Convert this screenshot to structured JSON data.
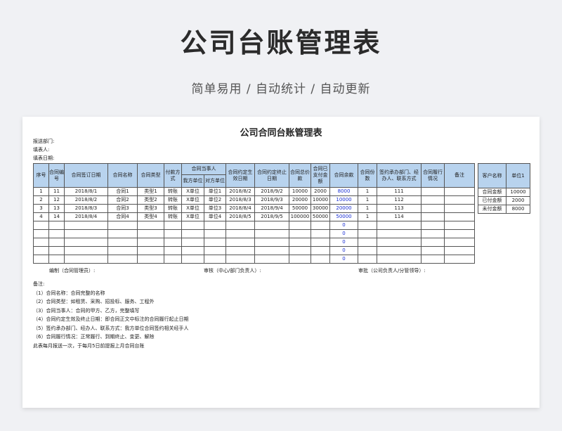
{
  "hero": {
    "title": "公司台账管理表",
    "subtitle": "简单易用 / 自动统计 / 自动更新"
  },
  "sheet": {
    "title": "公司合同台账管理表",
    "meta": [
      "报送部门:",
      "填表人:",
      "填表日期:"
    ],
    "headers": {
      "seq": "序号",
      "contract_no": "合同编号",
      "sign_date": "合同签订日期",
      "name": "合同名称",
      "type": "合同类型",
      "pay_method": "付款方式",
      "party": "合同当事人",
      "party_a": "我方单位",
      "party_b": "对方单位",
      "effective": "合同约定生效日期",
      "end": "合同约定终止日期",
      "total": "合同总价款",
      "paid": "合同已支付金额",
      "balance": "合同余款",
      "copies": "合同份数",
      "dept": "签约承办部门、经办人、联系方式",
      "status": "合同履行情况",
      "remark": "备注"
    },
    "rows": [
      {
        "seq": "1",
        "no": "11",
        "date": "2018/8/1",
        "name": "合同1",
        "type": "类型1",
        "pay": "转账",
        "a": "X单位",
        "b": "单位1",
        "eff": "2018/8/2",
        "end": "2018/9/2",
        "total": "10000",
        "paid": "2000",
        "bal": "8000",
        "copies": "1",
        "dept": "111"
      },
      {
        "seq": "2",
        "no": "12",
        "date": "2018/8/2",
        "name": "合同2",
        "type": "类型2",
        "pay": "转账",
        "a": "X单位",
        "b": "单位2",
        "eff": "2018/8/3",
        "end": "2018/9/3",
        "total": "20000",
        "paid": "10000",
        "bal": "10000",
        "copies": "1",
        "dept": "112"
      },
      {
        "seq": "3",
        "no": "13",
        "date": "2018/8/3",
        "name": "合同3",
        "type": "类型3",
        "pay": "转账",
        "a": "X单位",
        "b": "单位3",
        "eff": "2018/8/4",
        "end": "2018/9/4",
        "total": "50000",
        "paid": "30000",
        "bal": "20000",
        "copies": "1",
        "dept": "113"
      },
      {
        "seq": "4",
        "no": "14",
        "date": "2018/8/4",
        "name": "合同4",
        "type": "类型4",
        "pay": "转账",
        "a": "X单位",
        "b": "单位4",
        "eff": "2018/8/5",
        "end": "2018/9/5",
        "total": "100000",
        "paid": "50000",
        "bal": "50000",
        "copies": "1",
        "dept": "114"
      },
      {
        "seq": "",
        "no": "",
        "date": "",
        "name": "",
        "type": "",
        "pay": "",
        "a": "",
        "b": "",
        "eff": "",
        "end": "",
        "total": "",
        "paid": "",
        "bal": "0",
        "copies": "",
        "dept": ""
      },
      {
        "seq": "",
        "no": "",
        "date": "",
        "name": "",
        "type": "",
        "pay": "",
        "a": "",
        "b": "",
        "eff": "",
        "end": "",
        "total": "",
        "paid": "",
        "bal": "0",
        "copies": "",
        "dept": ""
      },
      {
        "seq": "",
        "no": "",
        "date": "",
        "name": "",
        "type": "",
        "pay": "",
        "a": "",
        "b": "",
        "eff": "",
        "end": "",
        "total": "",
        "paid": "",
        "bal": "0",
        "copies": "",
        "dept": ""
      },
      {
        "seq": "",
        "no": "",
        "date": "",
        "name": "",
        "type": "",
        "pay": "",
        "a": "",
        "b": "",
        "eff": "",
        "end": "",
        "total": "",
        "paid": "",
        "bal": "0",
        "copies": "",
        "dept": ""
      },
      {
        "seq": "",
        "no": "",
        "date": "",
        "name": "",
        "type": "",
        "pay": "",
        "a": "",
        "b": "",
        "eff": "",
        "end": "",
        "total": "",
        "paid": "",
        "bal": "0",
        "copies": "",
        "dept": ""
      }
    ],
    "side": {
      "headers": [
        "客户名称",
        "单位1"
      ],
      "rows": [
        [
          "合同金额",
          "10000"
        ],
        [
          "已付金额",
          "2000"
        ],
        [
          "未付金额",
          "8000"
        ]
      ]
    },
    "sign": [
      "编制（合同管理员）:",
      "审核（中心/部门负责人）:",
      "审批（公司负责人/分管领导）:"
    ],
    "notes": [
      "备注:",
      "（1）合同名称：合同完整的名称",
      "（2）合同类型：如租赁、采购、招投标、服务、工程外",
      "（3）合同当事人：合同的甲方、乙方，完整填写",
      "（4）合同约定生效及终止日期：即合同正文中标注的合同履行起止日期",
      "（5）签约承办部门、经办人、联系方式：我方单位合同签约相关经手人",
      "（6）合同履行情况：正常履行、到期终止、变更、解除",
      "   此表每月报送一次，于每月5日前提报上月合同台账"
    ]
  },
  "colors": {
    "header_bg": "#b8d3ee",
    "balance_text": "#1a2fd4"
  }
}
